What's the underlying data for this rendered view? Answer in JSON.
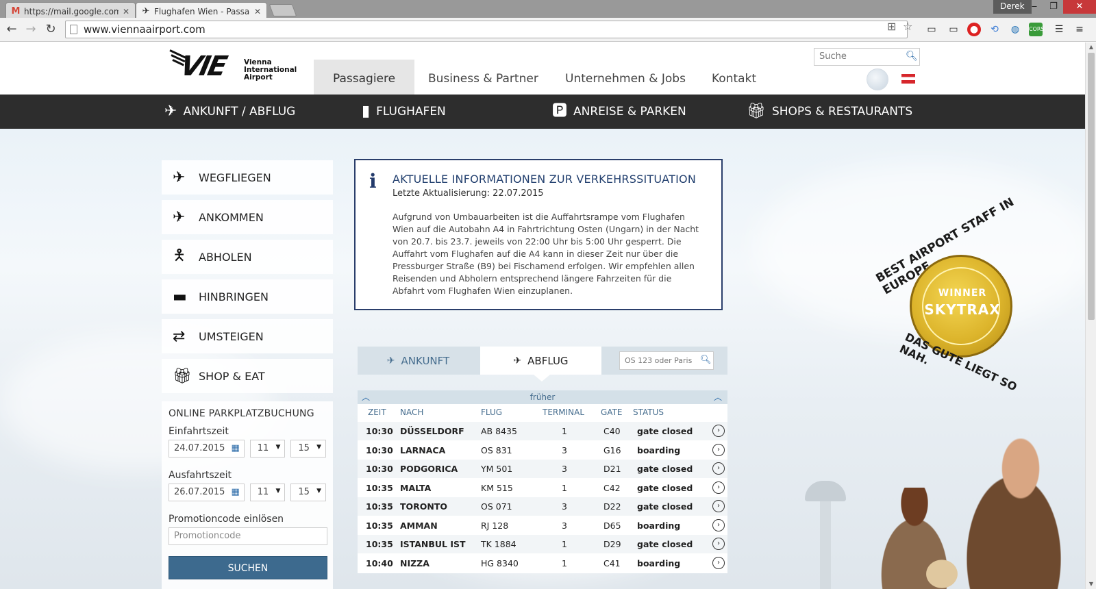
{
  "browser": {
    "tabs": [
      {
        "title": "https://mail.google.com/",
        "favicon": "gmail-icon",
        "active": false
      },
      {
        "title": "Flughafen Wien - Passagie",
        "favicon": "plane-icon",
        "active": true
      }
    ],
    "user": "Derek",
    "url": "www.viennaairport.com"
  },
  "header": {
    "logo_mark": "VIE",
    "logo_lines": [
      "Vienna",
      "International",
      "Airport"
    ],
    "nav": [
      "Passagiere",
      "Business & Partner",
      "Unternehmen & Jobs",
      "Kontakt"
    ],
    "active_nav": "Passagiere",
    "search_placeholder": "Suche"
  },
  "darknav": [
    "ANKUNFT / ABFLUG",
    "FLUGHAFEN",
    "ANREISE & PARKEN",
    "SHOPS & RESTAURANTS"
  ],
  "sidemenu": [
    "WEGFLIEGEN",
    "ANKOMMEN",
    "ABHOLEN",
    "HINBRINGEN",
    "UMSTEIGEN",
    "SHOP & EAT"
  ],
  "parking": {
    "title": "ONLINE PARKPLATZBUCHUNG",
    "entry_label": "Einfahrtszeit",
    "entry_date": "24.07.2015",
    "entry_hour": "11",
    "entry_min": "15",
    "exit_label": "Ausfahrtszeit",
    "exit_date": "26.07.2015",
    "exit_hour": "11",
    "exit_min": "15",
    "promo_label": "Promotioncode einlösen",
    "promo_placeholder": "Promotioncode",
    "button": "SUCHEN"
  },
  "info": {
    "title": "AKTUELLE INFORMATIONEN ZUR VERKEHRSSITUATION",
    "date": "Letzte Aktualisierung: 22.07.2015",
    "body": "Aufgrund von Umbauarbeiten ist die Auffahrtsrampe vom Flughafen Wien auf die Autobahn A4 in Fahrtrichtung Osten (Ungarn) in der Nacht von 20.7. bis 23.7. jeweils von 22:00 Uhr bis 5:00 Uhr gesperrt. Die Auffahrt vom Flughafen auf die A4 kann in dieser Zeit nur über die Pressburger Straße (B9) bei Fischamend erfolgen. Wir empfehlen allen Reisenden und Abholern entsprechend längere Fahrzeiten für die Abfahrt vom Flughafen Wien einzuplanen."
  },
  "board": {
    "tab_arrival": "ANKUNFT",
    "tab_departure": "ABFLUG",
    "search_placeholder": "OS 123 oder Paris",
    "earlier": "früher",
    "headers": [
      "ZEIT",
      "NACH",
      "FLUG",
      "TERMINAL",
      "GATE",
      "STATUS"
    ],
    "rows": [
      {
        "time": "10:30",
        "dest": "DÜSSELDORF",
        "flight": "AB 8435",
        "terminal": "1",
        "gate": "C40",
        "status": "gate closed"
      },
      {
        "time": "10:30",
        "dest": "LARNACA",
        "flight": "OS 831",
        "terminal": "3",
        "gate": "G16",
        "status": "boarding"
      },
      {
        "time": "10:30",
        "dest": "PODGORICA",
        "flight": "YM 501",
        "terminal": "3",
        "gate": "D21",
        "status": "gate closed"
      },
      {
        "time": "10:35",
        "dest": "MALTA",
        "flight": "KM 515",
        "terminal": "1",
        "gate": "C42",
        "status": "gate closed"
      },
      {
        "time": "10:35",
        "dest": "TORONTO",
        "flight": "OS 071",
        "terminal": "3",
        "gate": "D22",
        "status": "gate closed"
      },
      {
        "time": "10:35",
        "dest": "AMMAN",
        "flight": "RJ 128",
        "terminal": "3",
        "gate": "D65",
        "status": "boarding"
      },
      {
        "time": "10:35",
        "dest": "ISTANBUL IST",
        "flight": "TK 1884",
        "terminal": "1",
        "gate": "D29",
        "status": "gate closed"
      },
      {
        "time": "10:40",
        "dest": "NIZZA",
        "flight": "HG 8340",
        "terminal": "1",
        "gate": "C41",
        "status": "boarding"
      }
    ]
  },
  "award": {
    "top": "BEST AIRPORT STAFF IN EUROPE.",
    "winner": "WINNER",
    "brand": "SKYTRAX",
    "bottom": "DAS GUTE LIEGT SO NAH."
  }
}
